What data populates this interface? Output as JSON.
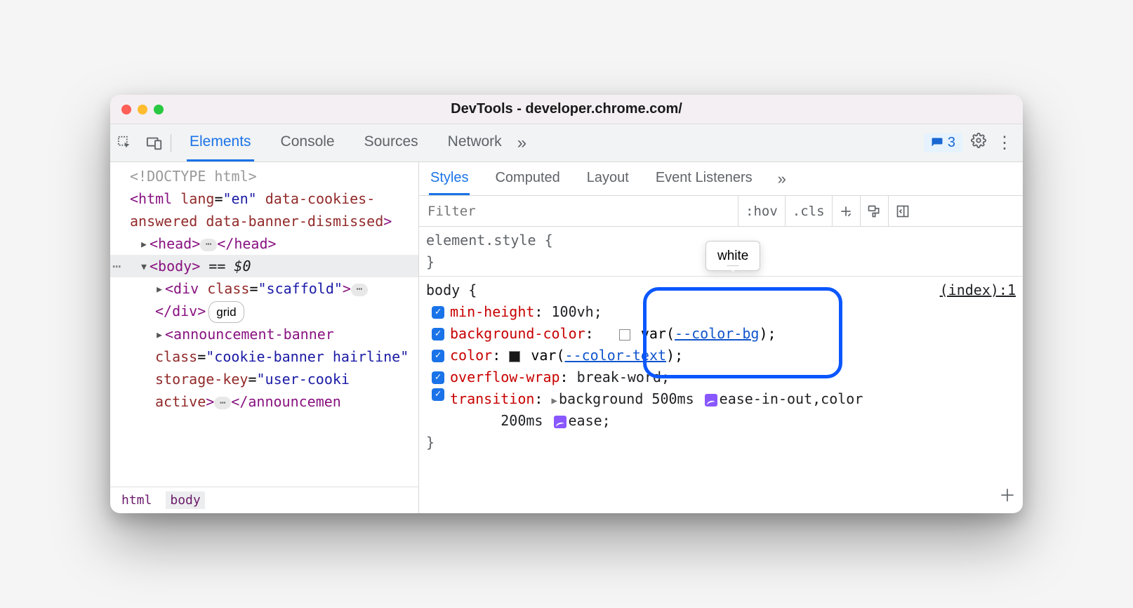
{
  "window_title": "DevTools - developer.chrome.com/",
  "toolbar": {
    "tabs": [
      "Elements",
      "Console",
      "Sources",
      "Network"
    ],
    "active_tab": 0,
    "issues_count": "3"
  },
  "dom": {
    "doctype": "<!DOCTYPE html>",
    "html_open": "<html lang=\"en\" data-cookies-answered data-banner-dismissed>",
    "head": "<head>",
    "head_close": "</head>",
    "body": "<body>",
    "body_sel": "== $0",
    "div_scaffold_open": "<div class=\"scaffold\">",
    "div_scaffold_close": "</div>",
    "grid_badge": "grid",
    "ann_open": "<announcement-banner class=\"cookie-banner hairline\" storage-key=\"user-cookie\" active>",
    "ann_close": "</announcement-"
  },
  "crumbs": [
    "html",
    "body"
  ],
  "crumb_active": 1,
  "sub_tabs": [
    "Styles",
    "Computed",
    "Layout",
    "Event Listeners"
  ],
  "sub_active": 0,
  "filter_placeholder": "Filter",
  "filter_btns": [
    ":hov",
    ".cls"
  ],
  "rules": {
    "element_style": "element.style {",
    "brace_close": "}",
    "body_selector": "body {",
    "source": "(index):1",
    "props": {
      "min_height": {
        "name": "min-height",
        "value": "100vh;"
      },
      "bg": {
        "name": "background-color",
        "var": "--color-bg",
        "tooltip": "white"
      },
      "color": {
        "name": "color",
        "var": "--color-text"
      },
      "overflow": {
        "name": "overflow-wrap",
        "value": "break-word;"
      },
      "transition": {
        "name": "transition",
        "v1": "background 500ms",
        "e1": "ease-in-out",
        "v2": ",color",
        "l2": "200ms",
        "e2": "ease;"
      }
    }
  }
}
